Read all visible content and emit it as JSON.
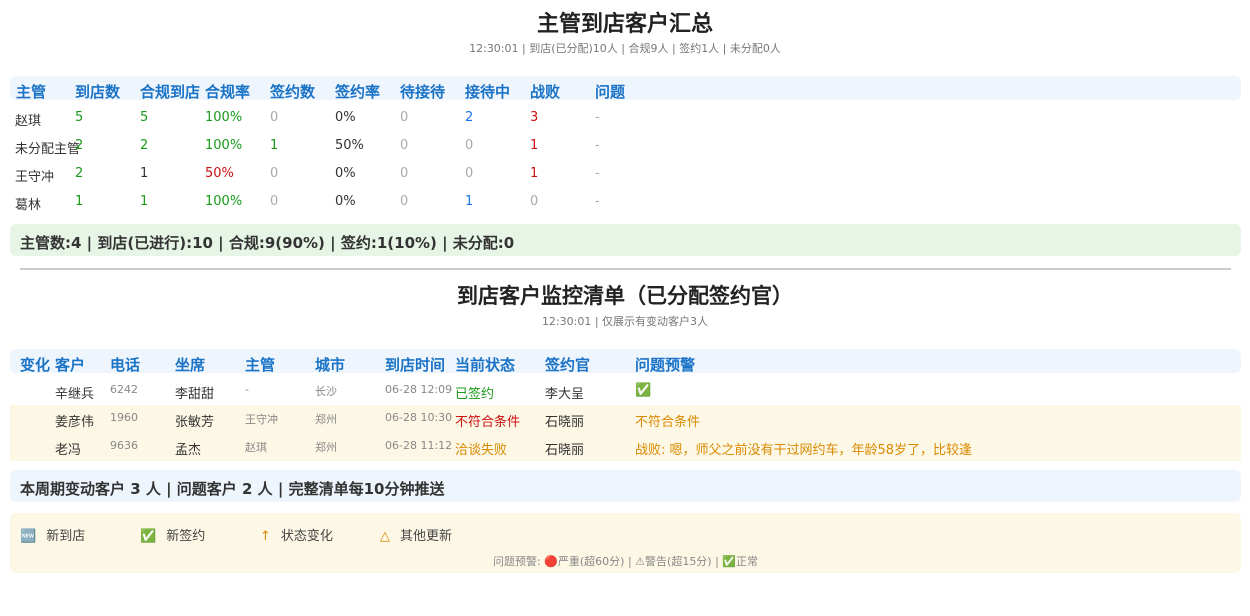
{
  "summary": {
    "title": "主管到店客户汇总",
    "subtitle": "12:30:01 | 到店(已分配)10人 | 合规9人 | 签约1人 | 未分配0人",
    "headers": [
      "主管",
      "到店数",
      "合规到店",
      "合规率",
      "签约数",
      "签约率",
      "待接待",
      "接待中",
      "战败",
      "问题"
    ],
    "rows": [
      {
        "name": "赵琪",
        "visits": "5",
        "compliant": "5",
        "rate": "100%",
        "signed": "0",
        "sign_rate": "0%",
        "waiting": "0",
        "serving": "2",
        "lost": "3",
        "issue": "-"
      },
      {
        "name": "未分配主管",
        "visits": "2",
        "compliant": "2",
        "rate": "100%",
        "signed": "1",
        "sign_rate": "50%",
        "waiting": "0",
        "serving": "0",
        "lost": "1",
        "issue": "-"
      },
      {
        "name": "王守冲",
        "visits": "2",
        "compliant": "1",
        "rate": "50%",
        "signed": "0",
        "sign_rate": "0%",
        "waiting": "0",
        "serving": "0",
        "lost": "1",
        "issue": "-"
      },
      {
        "name": "葛林",
        "visits": "1",
        "compliant": "1",
        "rate": "100%",
        "signed": "0",
        "sign_rate": "0%",
        "waiting": "0",
        "serving": "1",
        "lost": "0",
        "issue": "-"
      }
    ],
    "totals": "主管数:4 | 到店(已进行):10 | 合规:9(90%) | 签约:1(10%) | 未分配:0"
  },
  "monitor": {
    "title": "到店客户监控清单（已分配签约官）",
    "subtitle": "12:30:01 | 仅展示有变动客户3人",
    "headers": [
      "变化",
      "客户",
      "电话",
      "坐席",
      "主管",
      "城市",
      "到店时间",
      "当前状态",
      "签约官",
      "问题预警"
    ],
    "rows": [
      {
        "change": "",
        "customer": "辛继兵",
        "phone": "6242",
        "agent": "李甜甜",
        "supervisor": "-",
        "city": "长沙",
        "time": "06-28 12:09",
        "status": "已签约",
        "officer": "李大呈",
        "warning": "✅"
      },
      {
        "change": "",
        "customer": "姜彦伟",
        "phone": "1960",
        "agent": "张敏芳",
        "supervisor": "王守冲",
        "city": "郑州",
        "time": "06-28 10:30",
        "status": "不符合条件",
        "officer": "石晓丽",
        "warning": "不符合条件"
      },
      {
        "change": "",
        "customer": "老冯",
        "phone": "9636",
        "agent": "孟杰",
        "supervisor": "赵琪",
        "city": "郑州",
        "time": "06-28 11:12",
        "status": "洽谈失败",
        "officer": "石晓丽",
        "warning": "战败: 嗯，师父之前没有干过网约车，年龄58岁了，比较逢"
      }
    ],
    "totals": "本周期变动客户 3 人 | 问题客户 2 人 | 完整清单每10分钟推送"
  },
  "legend": {
    "items": [
      {
        "icon": "🆕",
        "label": "新到店"
      },
      {
        "icon": "✅",
        "label": "新签约"
      },
      {
        "icon": "↑",
        "label": "状态变化"
      },
      {
        "icon": "△",
        "label": "其他更新"
      }
    ],
    "footnote": "问题预警: 🔴严重(超60分) | ⚠警告(超15分) | ✅正常"
  },
  "colors": {
    "header_bg": "#eef5fd",
    "header_text": "#1a73c6",
    "green": "#1a9a1a",
    "red": "#cc1111",
    "blue": "#1a73e8",
    "orange": "#d98a00"
  }
}
